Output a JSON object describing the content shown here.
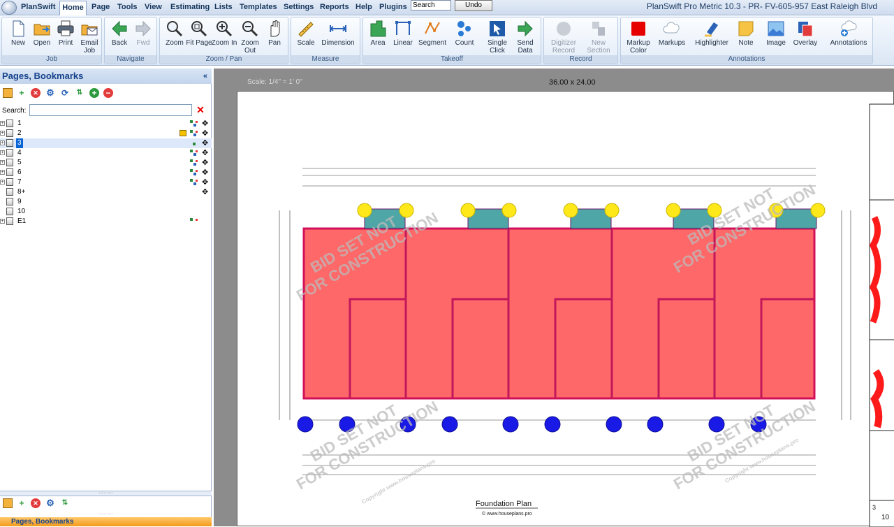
{
  "menubar": {
    "app_name": "PlanSwift",
    "items": [
      "Home",
      "Page",
      "Tools",
      "View",
      "Estimating",
      "Lists",
      "Templates",
      "Settings",
      "Reports",
      "Help",
      "Plugins"
    ],
    "search_placeholder": "Search",
    "undo_label": "Undo",
    "window_title": "PlanSwift Pro Metric 10.3 - PR- FV-605-957 East Raleigh Blvd"
  },
  "ribbon": {
    "groups": [
      {
        "label": "Job",
        "buttons": [
          "New",
          "Open",
          "Print",
          "Email Job"
        ]
      },
      {
        "label": "Navigate",
        "buttons": [
          "Back",
          "Fwd"
        ]
      },
      {
        "label": "Zoom / Pan",
        "buttons": [
          "Zoom",
          "Fit Page",
          "Zoom In",
          "Zoom Out",
          "Pan"
        ]
      },
      {
        "label": "Measure",
        "buttons": [
          "Scale",
          "Dimension"
        ]
      },
      {
        "label": "Takeoff",
        "buttons": [
          "Area",
          "Linear",
          "Segment",
          "Count",
          "Single Click",
          "Send Data"
        ]
      },
      {
        "label": "Record",
        "buttons": [
          "Digitizer Record",
          "New Section"
        ]
      },
      {
        "label": "Annotations",
        "buttons": [
          "Markup Color",
          "Markups",
          "Highlighter",
          "Note",
          "Image",
          "Overlay",
          "Annotations"
        ]
      }
    ]
  },
  "leftpane": {
    "title": "Pages, Bookmarks",
    "collapse_glyph": "«",
    "search_label": "Search:",
    "search_value": "",
    "pages": [
      "1",
      "2",
      "3",
      "4",
      "5",
      "6",
      "7",
      "8+",
      "9",
      "10",
      "E1"
    ],
    "selected_page": "3",
    "bottom_tab": "Pages, Bookmarks"
  },
  "document": {
    "scale": "Scale: 1/4\" = 1' 0\"",
    "sheet_size": "36.00 x 24.00",
    "plan_title": "Foundation Plan",
    "plan_website": "© www.houseplans.pro",
    "watermark_line1": "BID SET NOT",
    "watermark_line2": "FOR CONSTRUCTION",
    "copyright_mark": "Copyright www.houseplans.pro",
    "sheet_number": "3",
    "sheet_total": "10"
  },
  "colors": {
    "area_fill": "#ff4d4d",
    "area_border": "#d0105a",
    "porch_fill": "#3c9c9c",
    "count_yellow": "#ffe81a",
    "count_blue": "#1a1ae6"
  }
}
